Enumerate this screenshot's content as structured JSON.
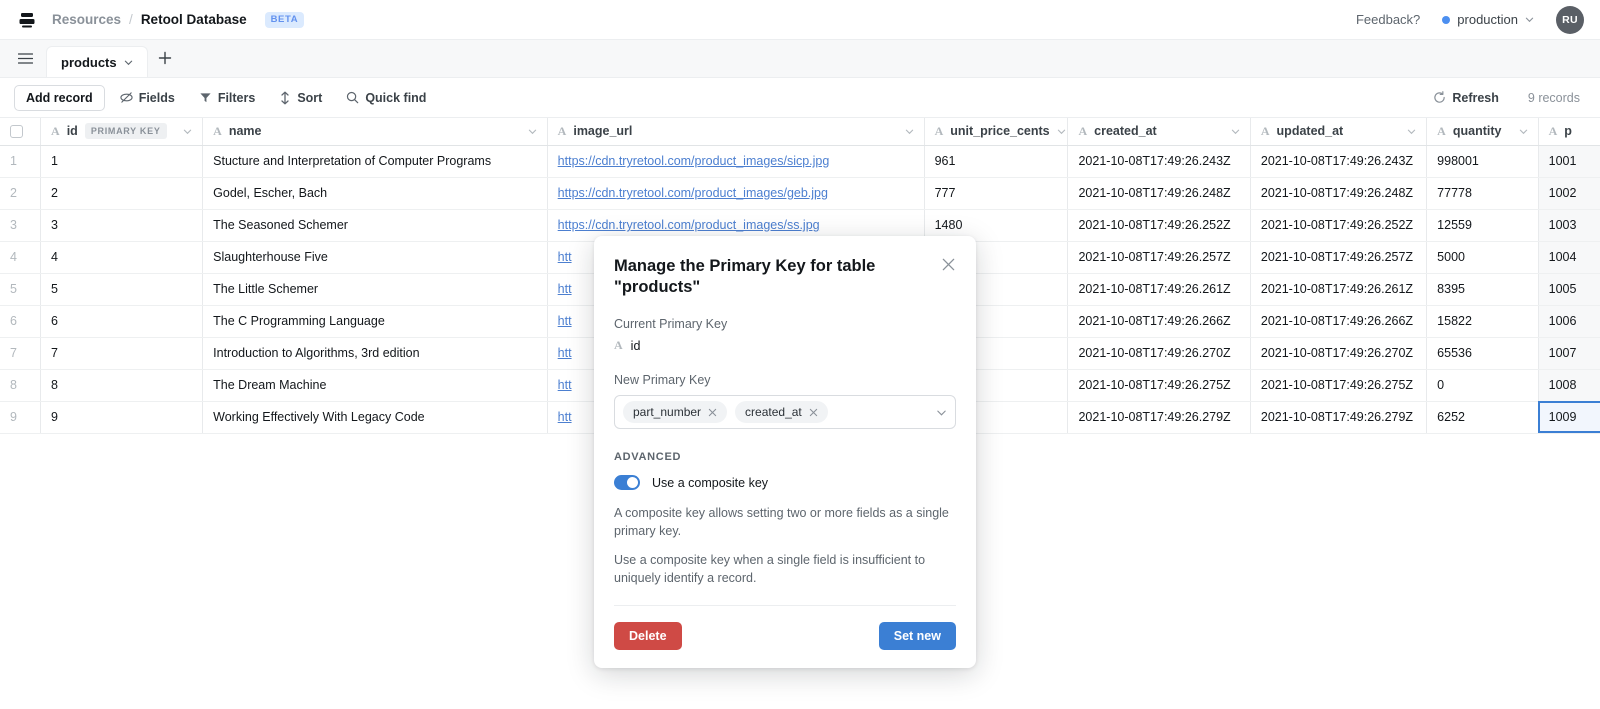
{
  "topbar": {
    "logo_icon": "database-logo-icon",
    "breadcrumb": {
      "parent": "Resources",
      "separator": "/",
      "current": "Retool Database"
    },
    "beta_badge": "BETA",
    "feedback": "Feedback?",
    "environment": "production",
    "avatar_initials": "RU",
    "accent_blue": "#4c8ff0"
  },
  "tabstrip": {
    "menu_icon": "hamburger-icon",
    "tab_label": "products",
    "tab_caret_icon": "chevron-down-icon",
    "add_tab_icon": "plus-icon"
  },
  "toolbar": {
    "add_record": "Add record",
    "fields": "Fields",
    "filters": "Filters",
    "sort": "Sort",
    "quick_find": "Quick find",
    "refresh": "Refresh",
    "records": "9 records"
  },
  "grid": {
    "columns": [
      {
        "key": "id",
        "label": "id",
        "type_icon": "A",
        "badge": "PRIMARY KEY"
      },
      {
        "key": "name",
        "label": "name",
        "type_icon": "A",
        "badge": ""
      },
      {
        "key": "image_url",
        "label": "image_url",
        "type_icon": "A",
        "badge": ""
      },
      {
        "key": "unit_price_cents",
        "label": "unit_price_cents",
        "type_icon": "A",
        "badge": ""
      },
      {
        "key": "created_at",
        "label": "created_at",
        "type_icon": "A",
        "badge": ""
      },
      {
        "key": "updated_at",
        "label": "updated_at",
        "type_icon": "A",
        "badge": ""
      },
      {
        "key": "quantity",
        "label": "quantity",
        "type_icon": "A",
        "badge": ""
      },
      {
        "key": "part_number",
        "label": "p",
        "type_icon": "A",
        "badge": ""
      }
    ],
    "rows": [
      {
        "n": "1",
        "id": "1",
        "name": "Stucture and Interpretation of Computer Programs",
        "image_url": "https://cdn.tryretool.com/product_images/sicp.jpg",
        "unit_price_cents": "961",
        "created_at": "2021-10-08T17:49:26.243Z",
        "updated_at": "2021-10-08T17:49:26.243Z",
        "quantity": "998001",
        "part_number": "1001"
      },
      {
        "n": "2",
        "id": "2",
        "name": "Godel, Escher, Bach",
        "image_url": "https://cdn.tryretool.com/product_images/geb.jpg",
        "unit_price_cents": "777",
        "created_at": "2021-10-08T17:49:26.248Z",
        "updated_at": "2021-10-08T17:49:26.248Z",
        "quantity": "77778",
        "part_number": "1002"
      },
      {
        "n": "3",
        "id": "3",
        "name": "The Seasoned Schemer",
        "image_url": "https://cdn.tryretool.com/product_images/ss.jpg",
        "unit_price_cents": "1480",
        "created_at": "2021-10-08T17:49:26.252Z",
        "updated_at": "2021-10-08T17:49:26.252Z",
        "quantity": "12559",
        "part_number": "1003"
      },
      {
        "n": "4",
        "id": "4",
        "name": "Slaughterhouse Five",
        "image_url": "htt",
        "unit_price_cents": "",
        "created_at": "2021-10-08T17:49:26.257Z",
        "updated_at": "2021-10-08T17:49:26.257Z",
        "quantity": "5000",
        "part_number": "1004"
      },
      {
        "n": "5",
        "id": "5",
        "name": "The Little Schemer",
        "image_url": "htt",
        "unit_price_cents": "",
        "created_at": "2021-10-08T17:49:26.261Z",
        "updated_at": "2021-10-08T17:49:26.261Z",
        "quantity": "8395",
        "part_number": "1005"
      },
      {
        "n": "6",
        "id": "6",
        "name": "The C Programming Language",
        "image_url": "htt",
        "unit_price_cents": "",
        "created_at": "2021-10-08T17:49:26.266Z",
        "updated_at": "2021-10-08T17:49:26.266Z",
        "quantity": "15822",
        "part_number": "1006"
      },
      {
        "n": "7",
        "id": "7",
        "name": "Introduction to Algorithms, 3rd edition",
        "image_url": "htt",
        "unit_price_cents": "",
        "created_at": "2021-10-08T17:49:26.270Z",
        "updated_at": "2021-10-08T17:49:26.270Z",
        "quantity": "65536",
        "part_number": "1007"
      },
      {
        "n": "8",
        "id": "8",
        "name": "The Dream Machine",
        "image_url": "htt",
        "unit_price_cents": "",
        "created_at": "2021-10-08T17:49:26.275Z",
        "updated_at": "2021-10-08T17:49:26.275Z",
        "quantity": "0",
        "part_number": "1008"
      },
      {
        "n": "9",
        "id": "9",
        "name": "Working Effectively With Legacy Code",
        "image_url": "htt",
        "unit_price_cents": "",
        "created_at": "2021-10-08T17:49:26.279Z",
        "updated_at": "2021-10-08T17:49:26.279Z",
        "quantity": "6252",
        "part_number": "1009"
      }
    ],
    "selected_cell": {
      "row": 9,
      "column": "part_number"
    }
  },
  "modal": {
    "title": "Manage the Primary Key for table \"products\"",
    "close_icon": "close-icon",
    "current_label": "Current Primary Key",
    "current_value": "id",
    "current_type_icon": "A",
    "new_label": "New Primary Key",
    "tags": [
      "part_number",
      "created_at"
    ],
    "select_caret_icon": "chevron-down-icon",
    "advanced_label": "ADVANCED",
    "toggle_label": "Use a composite key",
    "toggle_on": true,
    "help_1": "A composite key allows setting two or more fields as a single primary key.",
    "help_2": "Use a composite key when a single field is insufficient to uniquely identify a record.",
    "delete_label": "Delete",
    "confirm_label": "Set new",
    "delete_color": "#cf4a45",
    "confirm_color": "#3b7fd4"
  }
}
